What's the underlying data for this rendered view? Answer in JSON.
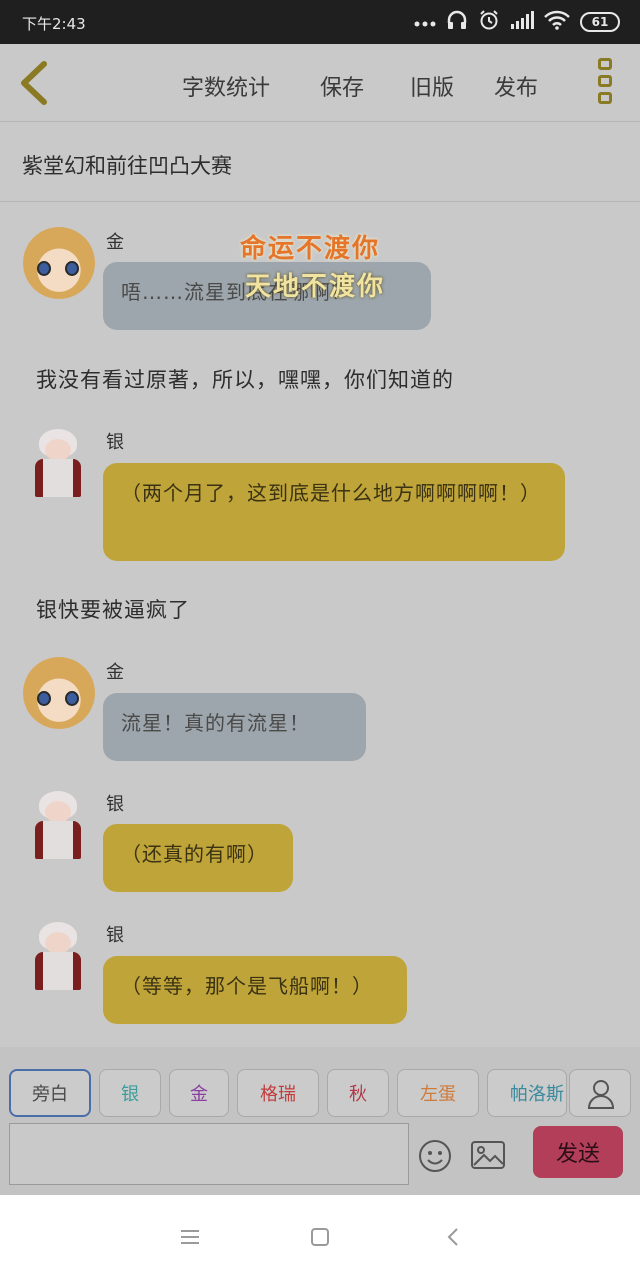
{
  "status_bar": {
    "time": "下午2:43",
    "battery": "61"
  },
  "toolbar": {
    "word_count": "字数统计",
    "save": "保存",
    "old_version": "旧版",
    "publish": "发布"
  },
  "story": {
    "title": "紫堂幻和前往凹凸大赛"
  },
  "overlay": {
    "line1": "命运不渡你",
    "line2": "天地不渡你"
  },
  "messages": [
    {
      "speaker": "金",
      "text": "唔……流星到底在哪啊?"
    },
    {
      "narration": "我没有看过原著，所以，嘿嘿，你们知道的"
    },
    {
      "speaker": "银",
      "text": "（两个月了，这到底是什么地方啊啊啊啊！）"
    },
    {
      "narration": "银快要被逼疯了"
    },
    {
      "speaker": "金",
      "text": "流星！真的有流星！"
    },
    {
      "speaker": "银",
      "text": "（还真的有啊）"
    },
    {
      "speaker": "银",
      "text": "（等等，那个是飞船啊！）"
    }
  ],
  "characters": [
    {
      "label": "旁白",
      "color": "#4a4a4a"
    },
    {
      "label": "银",
      "color": "#3e9d9b"
    },
    {
      "label": "金",
      "color": "#8a3fa0"
    },
    {
      "label": "格瑞",
      "color": "#c23d3d"
    },
    {
      "label": "秋",
      "color": "#b03a4a"
    },
    {
      "label": "左蛋",
      "color": "#d07a3a"
    },
    {
      "label": "帕洛斯",
      "color": "#3a8a9d"
    }
  ],
  "composer": {
    "input_value": "",
    "send": "发送"
  }
}
